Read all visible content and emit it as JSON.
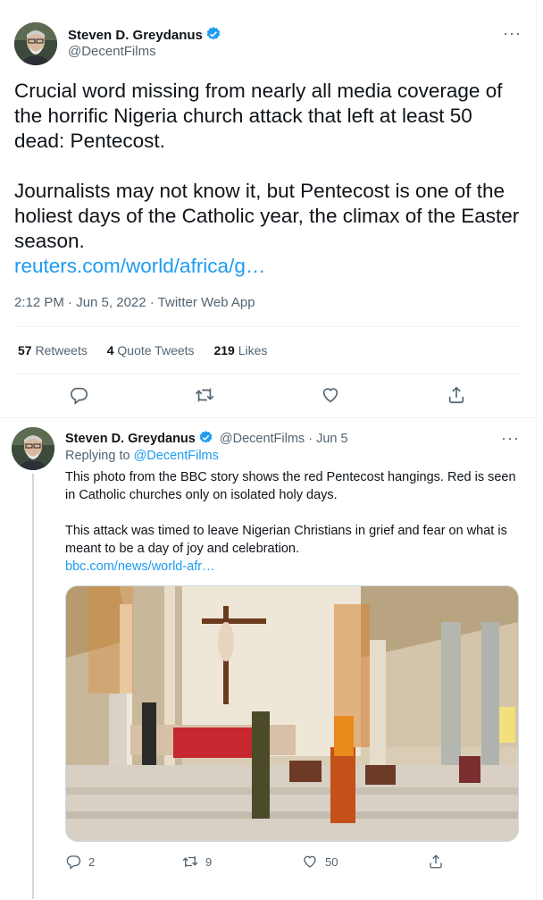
{
  "main_tweet": {
    "author_name": "Steven D. Greydanus",
    "author_handle": "@DecentFilms",
    "text_p1": "Crucial word missing from nearly all media coverage of the horrific Nigeria church attack that left at least 50 dead: Pentecost.",
    "text_p2": "Journalists may not know it, but Pentecost is one of the holiest days of the Catholic year, the climax of the Easter season.",
    "link": "reuters.com/world/africa/g…",
    "timestamp": "2:12 PM · Jun 5, 2022 · Twitter Web App",
    "stats": {
      "retweets_count": "57",
      "retweets_label": "Retweets",
      "quotes_count": "4",
      "quotes_label": "Quote Tweets",
      "likes_count": "219",
      "likes_label": "Likes"
    },
    "more_label": "···"
  },
  "reply_tweet": {
    "author_name": "Steven D. Greydanus",
    "author_handle": "@DecentFilms",
    "date": "· Jun 5",
    "replying_prefix": "Replying to",
    "replying_handle": "@DecentFilms",
    "text_p1": "This photo from the BBC story shows the red Pentecost hangings. Red is seen in Catholic churches only on isolated holy days.",
    "text_p2": "This attack was timed to leave Nigerian Christians in grief and fear on what is meant to be a day of joy and celebration.",
    "link": "bbc.com/news/world-afr…",
    "replies": "2",
    "retweets": "9",
    "likes": "50",
    "more_label": "···"
  },
  "icons": [
    "verified-badge-icon",
    "reply-icon",
    "retweet-icon",
    "like-icon",
    "share-icon"
  ],
  "colors": {
    "accent": "#1d9bf0",
    "text": "#0f1419",
    "muted": "#536471",
    "border": "#eff3f4"
  }
}
